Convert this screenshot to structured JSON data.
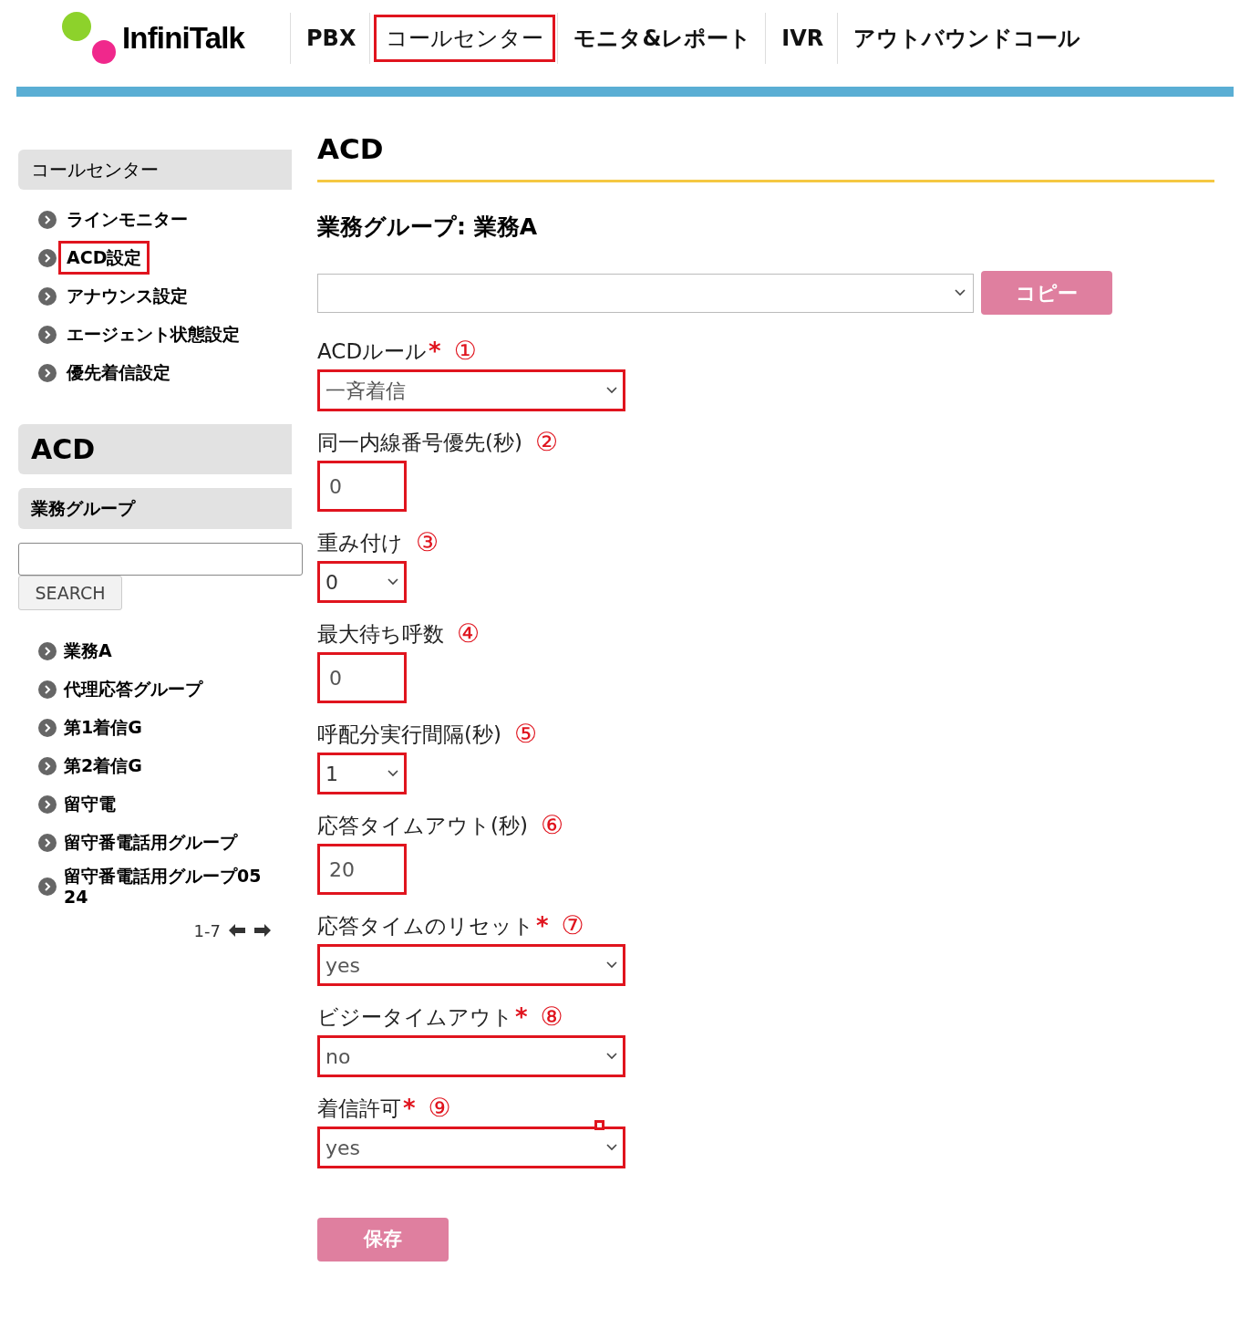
{
  "header": {
    "logo": "InfiniTalk",
    "nav": [
      {
        "label": "PBX",
        "highlighted": false
      },
      {
        "label": "コールセンター",
        "highlighted": true
      },
      {
        "label": "モニタ&レポート",
        "highlighted": false
      },
      {
        "label": "IVR",
        "highlighted": false
      },
      {
        "label": "アウトバウンドコール",
        "highlighted": false
      }
    ]
  },
  "sidebar": {
    "section_title": "コールセンター",
    "menu": [
      {
        "label": "ラインモニター",
        "highlighted": false
      },
      {
        "label": "ACD設定",
        "highlighted": true
      },
      {
        "label": "アナウンス設定",
        "highlighted": false
      },
      {
        "label": "エージェント状態設定",
        "highlighted": false
      },
      {
        "label": "優先着信設定",
        "highlighted": false
      }
    ],
    "acd_title": "ACD",
    "group_title": "業務グループ",
    "search_button": "SEARCH",
    "groups": [
      "業務A",
      "代理応答グループ",
      "第1着信G",
      "第2着信G",
      "留守電",
      "留守番電話用グループ",
      "留守番電話用グループ0524"
    ],
    "pagination": "1-7"
  },
  "main": {
    "title": "ACD",
    "subtitle": "業務グループ: 業務A",
    "copy_button": "コピー",
    "fields": [
      {
        "label": "ACDルール",
        "required_mark": "*",
        "annotation": "①",
        "kind": "select",
        "narrow": false,
        "value": "一斉着信",
        "highlighted": true
      },
      {
        "label": "同一内線番号優先(秒)",
        "annotation": "②",
        "kind": "input",
        "narrow": true,
        "value": "0",
        "highlighted": true
      },
      {
        "label": "重み付け",
        "annotation": "③",
        "kind": "select",
        "narrow": true,
        "value": "0",
        "highlighted": true
      },
      {
        "label": "最大待ち呼数",
        "annotation": "④",
        "kind": "input",
        "narrow": true,
        "value": "0",
        "highlighted": true
      },
      {
        "label": "呼配分実行間隔(秒)",
        "annotation": "⑤",
        "kind": "select",
        "narrow": true,
        "value": "1",
        "highlighted": true
      },
      {
        "label": "応答タイムアウト(秒)",
        "annotation": "⑥",
        "kind": "input",
        "narrow": true,
        "value": "20",
        "highlighted": true
      },
      {
        "label": "応答タイムのリセット",
        "required_mark": "*",
        "annotation": "⑦",
        "kind": "select",
        "narrow": false,
        "value": "yes",
        "highlighted": true
      },
      {
        "label": "ビジータイムアウト",
        "required_mark": "*",
        "annotation": "⑧",
        "kind": "select",
        "narrow": false,
        "value": "no",
        "highlighted": true
      },
      {
        "label": "着信許可",
        "required_mark": "*",
        "annotation": "⑨",
        "kind": "select",
        "narrow": false,
        "value": "yes",
        "highlighted": true
      }
    ],
    "save_button": "保存"
  }
}
